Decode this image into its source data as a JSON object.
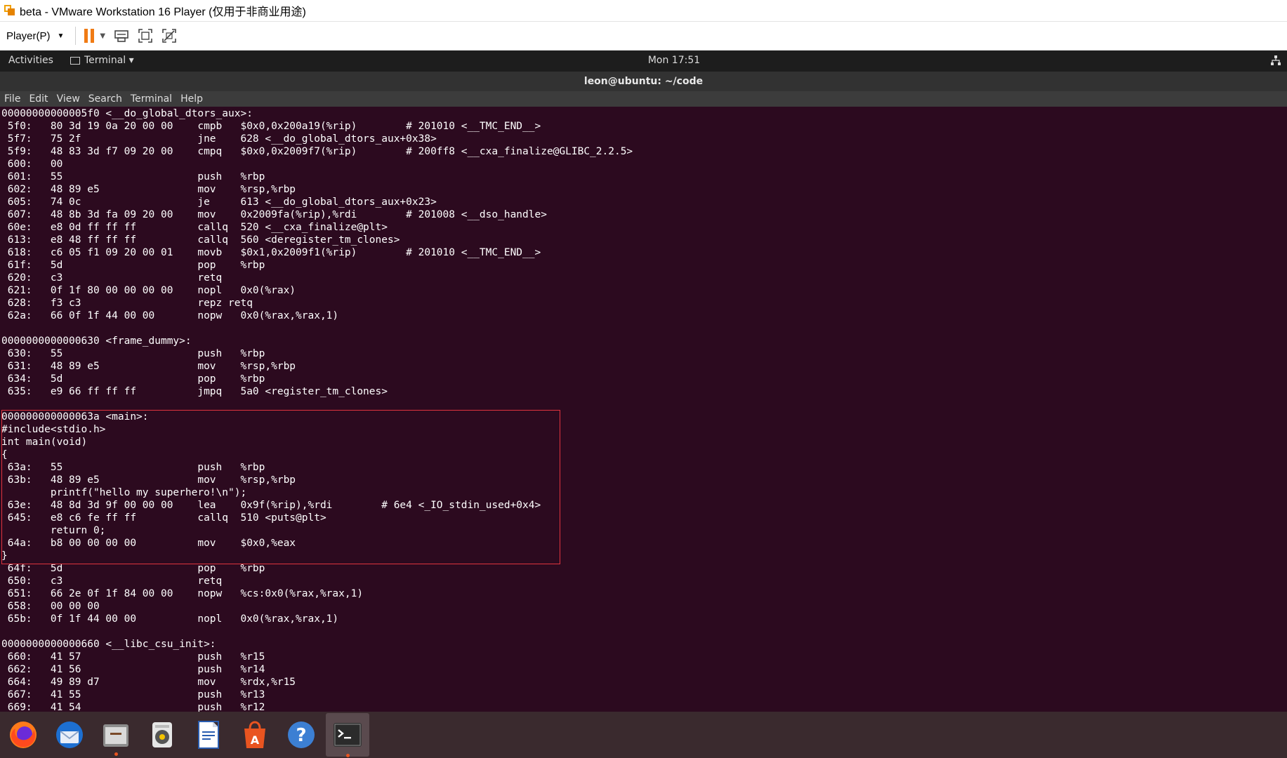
{
  "vmware": {
    "title": "beta - VMware Workstation 16 Player (仅用于非商业用途)",
    "player_menu": "Player(P)",
    "toolbar_icons": [
      "pause-icon",
      "send-ctrl-alt-del-icon",
      "fullscreen-icon",
      "unity-icon"
    ]
  },
  "topbar": {
    "activities": "Activities",
    "app_menu": "Terminal ▾",
    "clock": "Mon 17:51",
    "network_icon": "network-icon"
  },
  "terminal": {
    "title": "leon@ubuntu: ~/code",
    "menu": [
      "File",
      "Edit",
      "View",
      "Search",
      "Terminal",
      "Help"
    ],
    "lines": [
      "00000000000005f0 <__do_global_dtors_aux>:",
      " 5f0:   80 3d 19 0a 20 00 00    cmpb   $0x0,0x200a19(%rip)        # 201010 <__TMC_END__>",
      " 5f7:   75 2f                   jne    628 <__do_global_dtors_aux+0x38>",
      " 5f9:   48 83 3d f7 09 20 00    cmpq   $0x0,0x2009f7(%rip)        # 200ff8 <__cxa_finalize@GLIBC_2.2.5>",
      " 600:   00",
      " 601:   55                      push   %rbp",
      " 602:   48 89 e5                mov    %rsp,%rbp",
      " 605:   74 0c                   je     613 <__do_global_dtors_aux+0x23>",
      " 607:   48 8b 3d fa 09 20 00    mov    0x2009fa(%rip),%rdi        # 201008 <__dso_handle>",
      " 60e:   e8 0d ff ff ff          callq  520 <__cxa_finalize@plt>",
      " 613:   e8 48 ff ff ff          callq  560 <deregister_tm_clones>",
      " 618:   c6 05 f1 09 20 00 01    movb   $0x1,0x2009f1(%rip)        # 201010 <__TMC_END__>",
      " 61f:   5d                      pop    %rbp",
      " 620:   c3                      retq",
      " 621:   0f 1f 80 00 00 00 00    nopl   0x0(%rax)",
      " 628:   f3 c3                   repz retq",
      " 62a:   66 0f 1f 44 00 00       nopw   0x0(%rax,%rax,1)",
      "",
      "0000000000000630 <frame_dummy>:",
      " 630:   55                      push   %rbp",
      " 631:   48 89 e5                mov    %rsp,%rbp",
      " 634:   5d                      pop    %rbp",
      " 635:   e9 66 ff ff ff          jmpq   5a0 <register_tm_clones>",
      "",
      "000000000000063a <main>:",
      "#include<stdio.h>",
      "int main(void)",
      "{",
      " 63a:   55                      push   %rbp",
      " 63b:   48 89 e5                mov    %rsp,%rbp",
      "        printf(\"hello my superhero!\\n\");",
      " 63e:   48 8d 3d 9f 00 00 00    lea    0x9f(%rip),%rdi        # 6e4 <_IO_stdin_used+0x4>",
      " 645:   e8 c6 fe ff ff          callq  510 <puts@plt>",
      "        return 0;",
      " 64a:   b8 00 00 00 00          mov    $0x0,%eax",
      "}",
      " 64f:   5d                      pop    %rbp",
      " 650:   c3                      retq",
      " 651:   66 2e 0f 1f 84 00 00    nopw   %cs:0x0(%rax,%rax,1)",
      " 658:   00 00 00",
      " 65b:   0f 1f 44 00 00          nopl   0x0(%rax,%rax,1)",
      "",
      "0000000000000660 <__libc_csu_init>:",
      " 660:   41 57                   push   %r15",
      " 662:   41 56                   push   %r14",
      " 664:   49 89 d7                mov    %rdx,%r15",
      " 667:   41 55                   push   %r13",
      " 669:   41 54                   push   %r12"
    ]
  },
  "dock": {
    "items": [
      "firefox-icon",
      "thunderbird-icon",
      "files-icon",
      "rhythmbox-icon",
      "libreoffice-writer-icon",
      "software-center-icon",
      "help-icon",
      "terminal-icon"
    ],
    "active": "terminal-icon"
  },
  "colors": {
    "terminal_bg": "#2c0a1f",
    "highlight_border": "#e0343e",
    "vmware_accent": "#f07b14"
  }
}
